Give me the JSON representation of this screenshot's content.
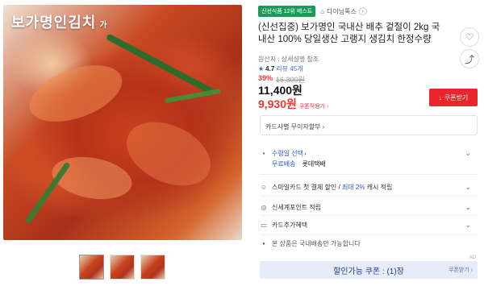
{
  "gallery": {
    "brand_overlay": "보가명인김치",
    "brand_overlay_sub": "가",
    "thumbnail_count": 3
  },
  "badge": "신선식품 12위 베스트",
  "store": {
    "name": "다이닝톡스",
    "chevron": "›"
  },
  "title": "(신선집중) 보가명인 국내산 배추 겉절이 2kg 국내산 100% 당일생산 고랭지 생김치 한정수량",
  "origin": "원산지 : 상세설명 참조",
  "rating": {
    "star": "★",
    "score": "4.7",
    "reviews": "리뷰 45개"
  },
  "discount": {
    "percent": "39%",
    "original_price": "16,300원"
  },
  "price": "11,400원",
  "coupon_price": "9,930원",
  "coupon_applied_label": "쿠폰적용가 ›",
  "coupon_button": {
    "icon": "↓",
    "label": "쿠폰받기"
  },
  "card_interest": "카드사별 무이자할부 ›",
  "shipping": {
    "label": "수령일 선택",
    "chevron": "›",
    "free_label": "무료배송",
    "carrier": "롯데택배"
  },
  "smilecard": {
    "text_before": "스마일카드 첫 결제 할인 / ",
    "highlight": "최대 2%",
    "text_after": " 캐시 적립"
  },
  "shinsegae": "신세계포인트 적립",
  "card_benefit": "카드추가혜택",
  "domestic_note": "본 상품은 국내배송만 가능합니다",
  "coupon_bar": {
    "label": "할인가능 쿠폰 : (1)장",
    "get": "쿠폰받기 ›",
    "tag": "AD"
  },
  "icons": {
    "heart": "♡",
    "share": "⤴",
    "chevron_down": "⌄",
    "truck": "🚚",
    "smile": "☺",
    "coin": "◎",
    "card": "▭",
    "info": "●"
  },
  "colors": {
    "red": "#e8262b",
    "blue": "#2b58c2",
    "green": "#1a9b5c"
  }
}
